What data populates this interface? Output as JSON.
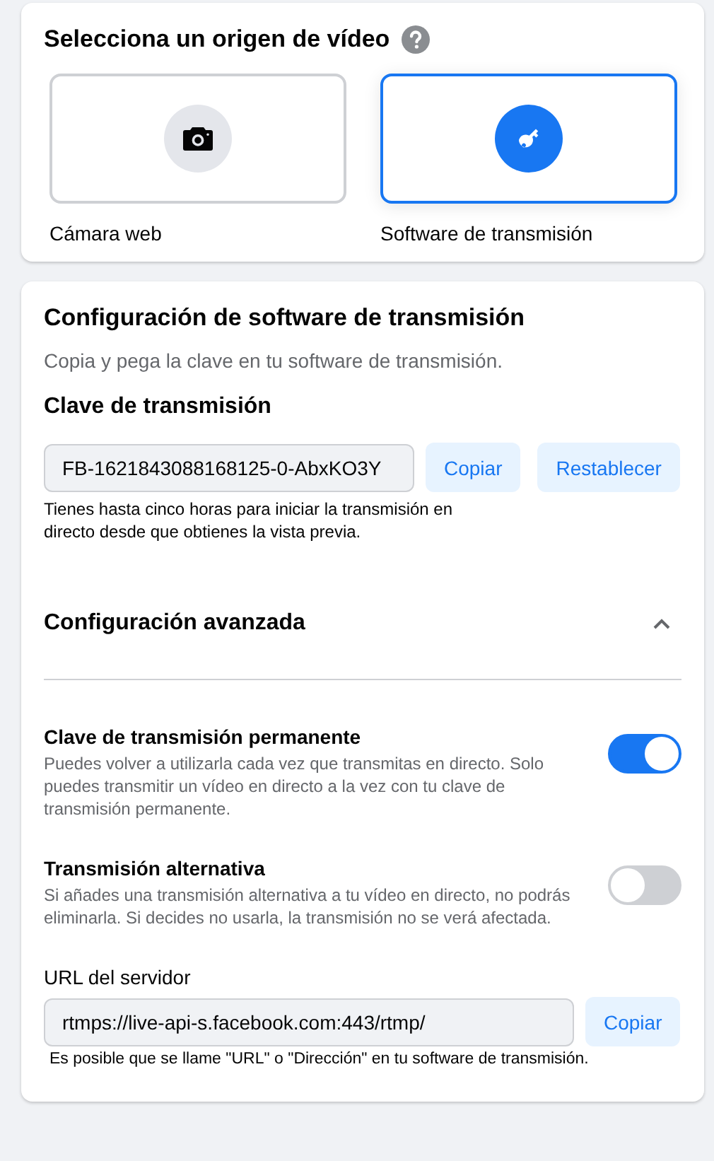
{
  "source_picker": {
    "title": "Selecciona un origen de vídeo",
    "options": [
      {
        "label": "Cámara web",
        "kind": "camera",
        "selected": false
      },
      {
        "label": "Software de transmisión",
        "kind": "key",
        "selected": true
      }
    ]
  },
  "stream_setup": {
    "title": "Configuración de software de transmisión",
    "subtitle": "Copia y pega la clave en tu software de transmisión.",
    "key_label": "Clave de transmisión",
    "key_value": "FB-1621843088168125-0-AbxKO3Y",
    "key_buttons": [
      "Copiar",
      "Restablecer"
    ],
    "key_note": "Tienes hasta cinco horas para iniciar la transmisión en directo desde que obtienes la vista previa.",
    "advanced": {
      "title": "Configuración avanzada",
      "expanded": true,
      "toggles": [
        {
          "title": "Clave de transmisión permanente",
          "description": "Puedes volver a utilizarla cada vez que transmitas en directo. Solo puedes transmitir un vídeo en directo a la vez con tu clave de transmisión permanente.",
          "on": true
        },
        {
          "title": "Transmisión alternativa",
          "description": "Si añades una transmisión alternativa a tu vídeo en directo, no podrás eliminarla. Si decides no usarla, la transmisión no se verá afectada.",
          "on": false
        }
      ],
      "server_url": {
        "label": "URL del servidor",
        "value": "rtmps://live-api-s.facebook.com:443/rtmp/",
        "button": "Copiar",
        "note": "Es posible que se llame \"URL\" o \"Dirección\" en tu software de transmisión."
      }
    }
  }
}
